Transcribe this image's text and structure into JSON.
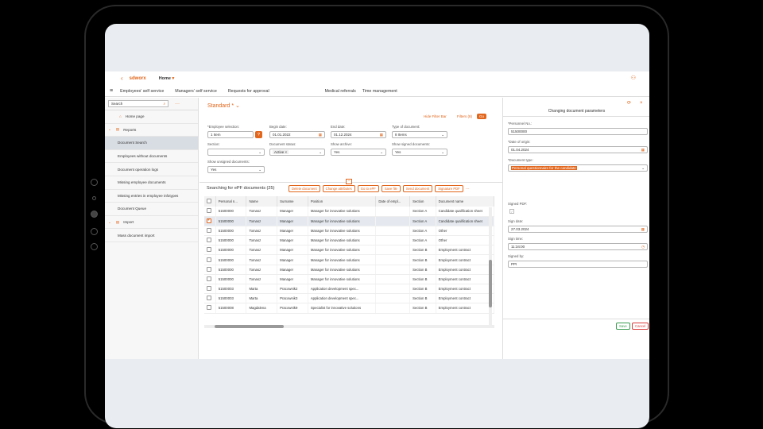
{
  "app": {
    "logo": "sdworx",
    "home_menu": "Home"
  },
  "nav": [
    "Employees' self service",
    "Managers' self service",
    "Requests for approval",
    "Medical referrals",
    "Time management"
  ],
  "sidebar": {
    "search_placeholder": "Search",
    "items": [
      {
        "label": "Home page",
        "type": "item"
      },
      {
        "label": "Reports",
        "type": "group"
      },
      {
        "label": "Document Search",
        "type": "item",
        "active": true
      },
      {
        "label": "Employees without documents",
        "type": "item"
      },
      {
        "label": "Document operation logs",
        "type": "item"
      },
      {
        "label": "Missing employee documents",
        "type": "item"
      },
      {
        "label": "Missing entries in employee infotypes",
        "type": "item"
      },
      {
        "label": "Document Queue",
        "type": "item"
      },
      {
        "label": "Import",
        "type": "group"
      },
      {
        "label": "Mass document import",
        "type": "item"
      }
    ]
  },
  "filter": {
    "variant": "Standard *",
    "hide_filter_bar": "Hide Filter Bar",
    "filters": "Filters (8)",
    "go": "Go",
    "fields": {
      "employee_selection": {
        "label": "*Employee selection:",
        "value": "1 Item"
      },
      "begin_date": {
        "label": "Begin date:",
        "value": "01.01.2022"
      },
      "end_date": {
        "label": "End date:",
        "value": "01.12.2024"
      },
      "type_of_document": {
        "label": "Type of document:",
        "value": "8 Items"
      },
      "section": {
        "label": "Section:",
        "value": ""
      },
      "document_status": {
        "label": "Document status:",
        "value": "Active"
      },
      "show_archive": {
        "label": "Show archive:",
        "value": "Yes"
      },
      "show_signed": {
        "label": "Show signed documents:",
        "value": "Yes"
      },
      "show_unsigned": {
        "label": "Show unsigned documents:",
        "value": "Yes"
      }
    }
  },
  "table": {
    "title": "Searching for ePF documents (25)",
    "actions": [
      "Delete document",
      "Change attributes",
      "Go to ePF",
      "Save file",
      "Send document",
      "Signature PDF"
    ],
    "columns": [
      "Personal n...",
      "Name",
      "Surname",
      "Position",
      "Date of empl...",
      "Section",
      "Document name"
    ],
    "rows": [
      {
        "pn": "51500000",
        "name": "Tomasz",
        "surname": "Manager",
        "position": "Manager for innovative solutions",
        "date": "",
        "section": "Section A",
        "doc": "Candidate qualification sheet",
        "selected": false
      },
      {
        "pn": "51500000",
        "name": "Tomasz",
        "surname": "Manager",
        "position": "Manager for innovative solutions",
        "date": "",
        "section": "Section A",
        "doc": "Candidate qualification sheet",
        "selected": true
      },
      {
        "pn": "51500000",
        "name": "Tomasz",
        "surname": "Manager",
        "position": "Manager for innovative solutions",
        "date": "",
        "section": "Section A",
        "doc": "Other",
        "selected": false
      },
      {
        "pn": "51500000",
        "name": "Tomasz",
        "surname": "Manager",
        "position": "Manager for innovative solutions",
        "date": "",
        "section": "Section A",
        "doc": "Other",
        "selected": false
      },
      {
        "pn": "51500000",
        "name": "Tomasz",
        "surname": "Manager",
        "position": "Manager for innovative solutions",
        "date": "",
        "section": "Section B",
        "doc": "Employment contract",
        "selected": false
      },
      {
        "pn": "51500000",
        "name": "Tomasz",
        "surname": "Manager",
        "position": "Manager for innovative solutions",
        "date": "",
        "section": "Section B",
        "doc": "Employment contract",
        "selected": false
      },
      {
        "pn": "51500000",
        "name": "Tomasz",
        "surname": "Manager",
        "position": "Manager for innovative solutions",
        "date": "",
        "section": "Section B",
        "doc": "Employment contract",
        "selected": false
      },
      {
        "pn": "51500000",
        "name": "Tomasz",
        "surname": "Manager",
        "position": "Manager for innovative solutions",
        "date": "",
        "section": "Section B",
        "doc": "Employment contract",
        "selected": false
      },
      {
        "pn": "51500003",
        "name": "Marta",
        "surname": "Pracownik2",
        "position": "Application development spec...",
        "date": "",
        "section": "Section B",
        "doc": "Employment contract",
        "selected": false
      },
      {
        "pn": "51500003",
        "name": "Marta",
        "surname": "Pracownik3",
        "position": "Application development spec...",
        "date": "",
        "section": "Section B",
        "doc": "Employment contract",
        "selected": false
      },
      {
        "pn": "51500008",
        "name": "Magdalena",
        "surname": "Pracownik9",
        "position": "Specialist for innovative solutions",
        "date": "",
        "section": "Section B",
        "doc": "Employment contract",
        "selected": false
      }
    ]
  },
  "panel": {
    "title": "Changing document parameters",
    "personnel_no_label": "*Personnel No.:",
    "personnel_no": "51500000",
    "date_origin_label": "*Date of origin:",
    "date_origin": "01.04.2024",
    "doc_type_label": "*Document type:",
    "doc_type": "Personal questionnaire for the candidate",
    "signed_pdf_label": "Signed PDF:",
    "sign_date_label": "Sign date:",
    "sign_date": "27.03.2024",
    "sign_time_label": "Sign time:",
    "sign_time": "11:34:00",
    "signed_by_label": "Signed by:",
    "signed_by": "PPI",
    "save": "Save",
    "cancel": "Cancel"
  },
  "colors": {
    "accent": "#e2661c"
  }
}
